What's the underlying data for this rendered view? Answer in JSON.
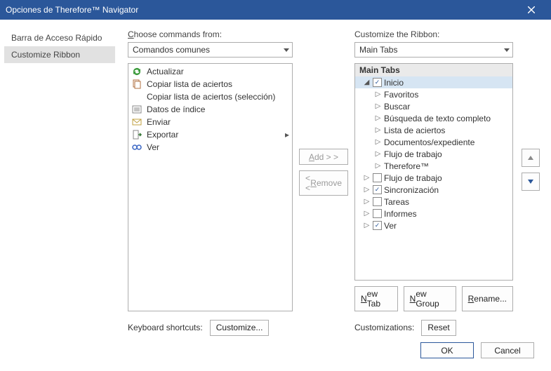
{
  "window": {
    "title": "Opciones de Therefore™ Navigator"
  },
  "sidebar": {
    "items": [
      {
        "label": "Barra de Acceso Rápido",
        "selected": false
      },
      {
        "label": "Customize Ribbon",
        "selected": true
      }
    ]
  },
  "left": {
    "label_pre": "",
    "label_ul": "C",
    "label_post": "hoose commands from:",
    "combo": "Comandos comunes",
    "commands": [
      {
        "icon": "refresh",
        "label": "Actualizar"
      },
      {
        "icon": "copy",
        "label": "Copiar lista de aciertos"
      },
      {
        "icon": "none",
        "label": "Copiar lista de aciertos (selección)"
      },
      {
        "icon": "index",
        "label": "Datos de índice"
      },
      {
        "icon": "mail",
        "label": "Enviar"
      },
      {
        "icon": "export",
        "label": "Exportar",
        "expand": true
      },
      {
        "icon": "view",
        "label": "Ver"
      }
    ],
    "shortcuts_label": "Keyboard shortcuts:",
    "customize_btn": "Customize..."
  },
  "mid": {
    "add_pre": "",
    "add_ul": "A",
    "add_post": "dd > >",
    "remove_pre": "< < ",
    "remove_ul": "R",
    "remove_post": "emove"
  },
  "right": {
    "label": "Customize the Ribbon:",
    "combo": "Main Tabs",
    "tree_header": "Main Tabs",
    "nodes": [
      {
        "depth": 0,
        "toggle": "expanded",
        "check": "checked",
        "label": "Inicio",
        "selected": true
      },
      {
        "depth": 1,
        "toggle": "collapsed",
        "check": "none",
        "label": "Favoritos"
      },
      {
        "depth": 1,
        "toggle": "collapsed",
        "check": "none",
        "label": "Buscar"
      },
      {
        "depth": 1,
        "toggle": "collapsed",
        "check": "none",
        "label": "Búsqueda de texto completo"
      },
      {
        "depth": 1,
        "toggle": "collapsed",
        "check": "none",
        "label": "Lista de aciertos"
      },
      {
        "depth": 1,
        "toggle": "collapsed",
        "check": "none",
        "label": "Documentos/expediente"
      },
      {
        "depth": 1,
        "toggle": "collapsed",
        "check": "none",
        "label": "Flujo de trabajo"
      },
      {
        "depth": 1,
        "toggle": "collapsed",
        "check": "none",
        "label": "Therefore™"
      },
      {
        "depth": 0,
        "toggle": "collapsed",
        "check": "unchecked",
        "label": "Flujo de trabajo"
      },
      {
        "depth": 0,
        "toggle": "collapsed",
        "check": "checked",
        "label": "Sincronización"
      },
      {
        "depth": 0,
        "toggle": "collapsed",
        "check": "unchecked",
        "label": "Tareas"
      },
      {
        "depth": 0,
        "toggle": "collapsed",
        "check": "unchecked",
        "label": "Informes"
      },
      {
        "depth": 0,
        "toggle": "collapsed",
        "check": "checked",
        "label": "Ver"
      }
    ],
    "btn_newtab_ul": "N",
    "btn_newtab_post": "ew Tab",
    "btn_newgrp_ul": "N",
    "btn_newgrp_post": "ew Group",
    "btn_rename_ul": "R",
    "btn_rename_post": "ename...",
    "cust_label": "Customizations:",
    "reset_btn": "Reset"
  },
  "footer": {
    "ok": "OK",
    "cancel": "Cancel"
  },
  "colors": {
    "accent": "#2b579a"
  }
}
